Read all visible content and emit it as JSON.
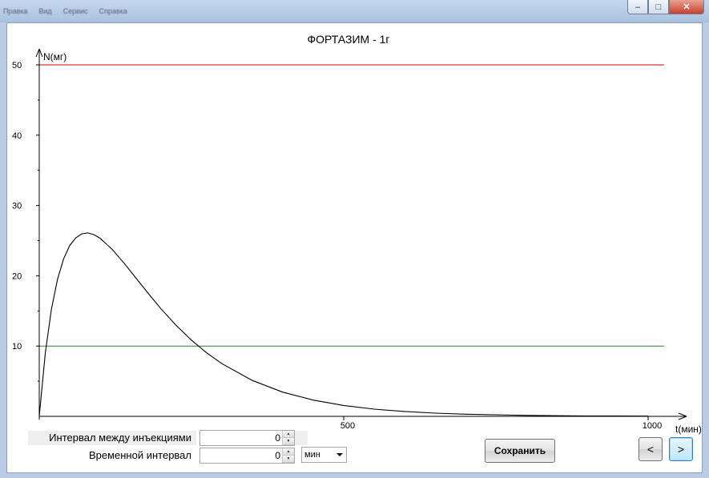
{
  "menu": [
    "Правка",
    "Вид",
    "Сервис",
    "Справка"
  ],
  "window_controls": {
    "minimize": "–",
    "maximize": "□",
    "close": "✕"
  },
  "chart_data": {
    "type": "line",
    "title": "ФОРТАЗИМ - 1г",
    "xlabel": "t(мин)",
    "ylabel": "N(мг)",
    "xlim": [
      0,
      1000
    ],
    "ylim": [
      0,
      50
    ],
    "x_ticks": [
      500,
      1000
    ],
    "y_ticks": [
      10,
      20,
      30,
      40,
      50
    ],
    "series": [
      {
        "color": "#000000",
        "x": [
          0,
          10,
          20,
          30,
          40,
          50,
          60,
          70,
          80,
          90,
          100,
          120,
          140,
          160,
          180,
          200,
          225,
          250,
          275,
          300,
          350,
          400,
          450,
          500,
          550,
          600,
          650,
          700,
          800,
          900,
          1000
        ],
        "y": [
          0,
          9.07,
          15.24,
          19.5,
          22.4,
          24.3,
          25.4,
          25.97,
          26.09,
          25.84,
          25.33,
          23.74,
          21.72,
          19.55,
          17.38,
          15.3,
          12.93,
          10.84,
          9.03,
          7.49,
          5.1,
          3.44,
          2.31,
          1.55,
          1.03,
          0.69,
          0.46,
          0.31,
          0.14,
          0.06,
          0.03
        ]
      }
    ],
    "reference_lines": [
      {
        "y": 50,
        "color": "#d00000"
      },
      {
        "y": 10,
        "color": "#228b22"
      }
    ]
  },
  "controls": {
    "injection_interval": {
      "label": "Интервал между инъекциями",
      "value": "0"
    },
    "time_interval": {
      "label": "Временной интервал",
      "value": "0"
    },
    "unit_select": {
      "value": "мин"
    },
    "save_label": "Сохранить",
    "prev_label": "<",
    "next_label": ">"
  }
}
